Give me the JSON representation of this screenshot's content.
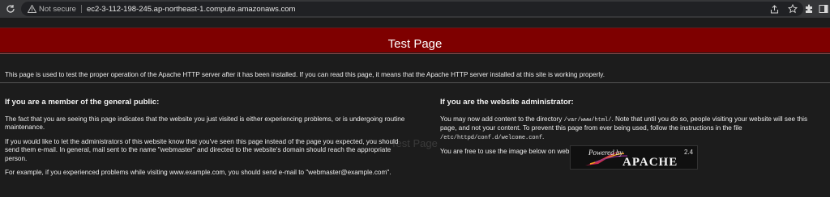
{
  "browser": {
    "security_label": "Not secure",
    "url": "ec2-3-112-198-245.ap-northeast-1.compute.amazonaws.com"
  },
  "page": {
    "title": "Test Page",
    "intro": "This page is used to test the proper operation of the Apache HTTP server after it has been installed. If you can read this page, it means that the Apache HTTP server installed at this site is working properly.",
    "left": {
      "heading": "If you are a member of the general public:",
      "p1": "The fact that you are seeing this page indicates that the website you just visited is either experiencing problems, or is undergoing routine maintenance.",
      "p2": "If you would like to let the administrators of this website know that you've seen this page instead of the page you expected, you should send them e-mail. In general, mail sent to the name \"webmaster\" and directed to the website's domain should reach the appropriate person.",
      "p3": "For example, if you experienced problems while visiting www.example.com, you should send e-mail to \"webmaster@example.com\"."
    },
    "right": {
      "heading": "If you are the website administrator:",
      "p1_a": "You may now add content to the directory ",
      "p1_dir": "/var/www/html/",
      "p1_b": ". Note that until you do so, people visiting your website will see this page, and not your content. To prevent this page from ever being used, follow the instructions in the file ",
      "p1_file": "/etc/httpd/conf.d/welcome.conf",
      "p1_c": ".",
      "p2": "You are free to use the image below on web sites powered by the Apache HTTP Server:"
    },
    "badge": {
      "powered": "Powered by",
      "version": "2.4",
      "name": "APACHE"
    }
  },
  "colors": {
    "banner": "#7e0000",
    "background": "#1c1c1c"
  }
}
